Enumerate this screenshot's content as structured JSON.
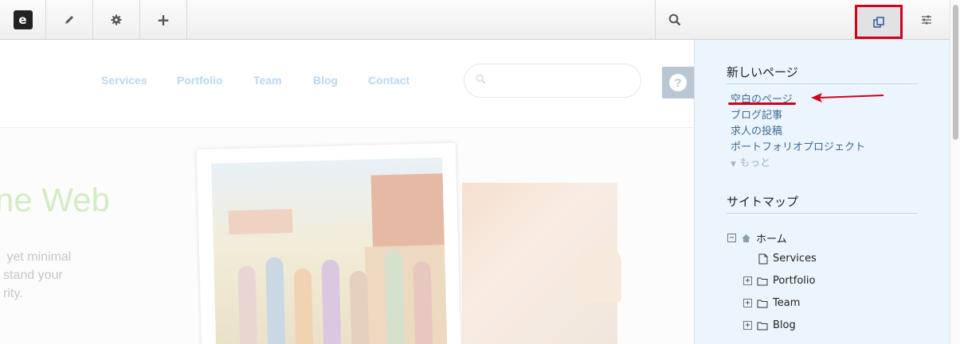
{
  "toolbar": {
    "logo_glyph": "e",
    "edit_icon": "pencil-icon",
    "settings_icon": "gear-icon",
    "add_glyph": "+",
    "search_icon": "search-icon",
    "pages_icon": "copy-pages-icon",
    "panel_settings_icon": "sliders-icon",
    "highlight_color": "#d0021b"
  },
  "site": {
    "nav": [
      "Services",
      "Portfolio",
      "Team",
      "Blog",
      "Contact"
    ],
    "help_glyph": "?",
    "hero_title": "ne Web",
    "hero_text": " yet minimal\nstand your\nrity."
  },
  "panel": {
    "new_page_heading": "新しいページ",
    "page_types": [
      "空白のページ",
      "ブログ記事",
      "求人の投稿",
      "ポートフォリオプロジェクト"
    ],
    "more_label": "もっと",
    "sitemap_heading": "サイトマップ",
    "sitemap": {
      "home": "ホーム",
      "children": [
        "Services",
        "Portfolio",
        "Team",
        "Blog"
      ]
    }
  }
}
